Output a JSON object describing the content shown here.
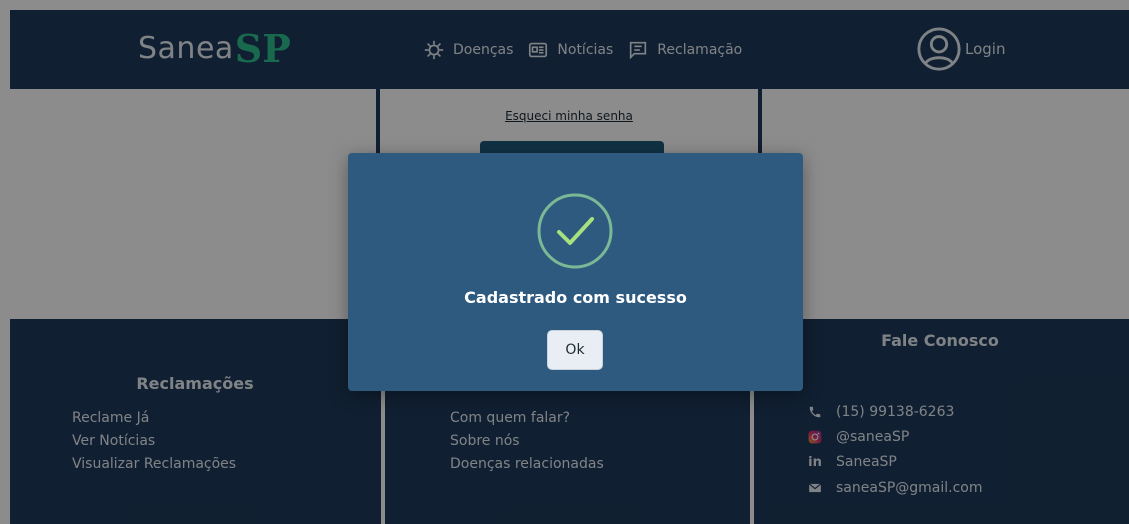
{
  "header": {
    "logo_text": "Sanea",
    "logo_mark": "SP",
    "nav": [
      {
        "label": "Doenças",
        "icon": "virus-icon"
      },
      {
        "label": "Notícias",
        "icon": "newspaper-icon"
      },
      {
        "label": "Reclamação",
        "icon": "comment-icon"
      }
    ],
    "login_label": "Login"
  },
  "card": {
    "forgot_password": "Esqueci minha senha"
  },
  "footer": {
    "col1": {
      "title": "Reclamações",
      "links": [
        "Reclame Já",
        "Ver Notícias",
        "Visualizar Reclamações"
      ]
    },
    "col2": {
      "links": [
        "Com quem falar?",
        "Sobre nós",
        "Doenças relacionadas"
      ]
    },
    "col3": {
      "title": "Fale Conosco",
      "contacts": [
        {
          "icon": "phone-icon",
          "text": "(15) 99138-6263"
        },
        {
          "icon": "instagram-icon",
          "text": "@saneaSP"
        },
        {
          "icon": "linkedin-icon",
          "text": "SaneaSP"
        },
        {
          "icon": "mail-icon",
          "text": "saneaSP@gmail.com"
        }
      ]
    }
  },
  "modal": {
    "title": "Cadastrado com sucesso",
    "ok_label": "Ok"
  },
  "colors": {
    "brand_dark": "#1e3a5a",
    "modal_bg": "#2e5a80",
    "accent_green": "#2fbf8f"
  }
}
